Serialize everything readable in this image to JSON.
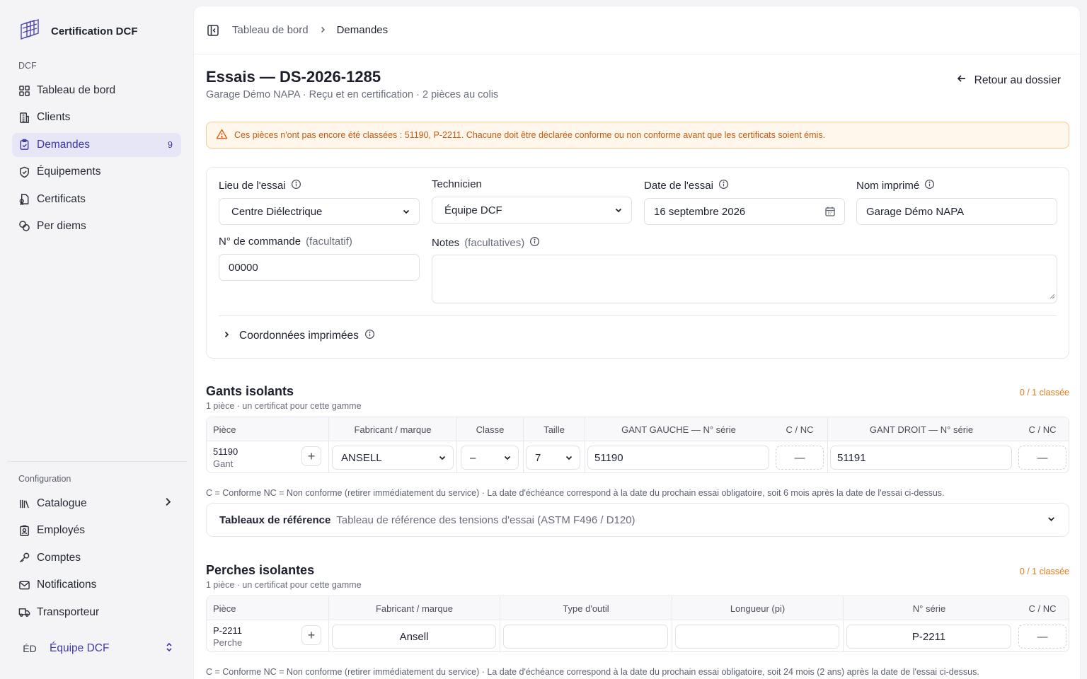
{
  "brand": {
    "name": "Certification DCF"
  },
  "sidebar": {
    "section_dcf": "DCF",
    "items": [
      {
        "label": "Tableau de bord",
        "icon": "dashboard-icon"
      },
      {
        "label": "Clients",
        "icon": "building-icon"
      },
      {
        "label": "Demandes",
        "icon": "clipboard-icon",
        "badge": "9",
        "active": true
      },
      {
        "label": "Équipements",
        "icon": "shield-icon"
      },
      {
        "label": "Certificats",
        "icon": "certificate-icon"
      },
      {
        "label": "Per diems",
        "icon": "coins-icon"
      }
    ],
    "section_config": "Configuration",
    "config_items": [
      {
        "label": "Catalogue",
        "icon": "library-icon"
      },
      {
        "label": "Employés",
        "icon": "badge-icon"
      },
      {
        "label": "Comptes",
        "icon": "key-icon"
      },
      {
        "label": "Notifications",
        "icon": "mail-icon"
      },
      {
        "label": "Transporteur",
        "icon": "truck-icon"
      }
    ],
    "team": {
      "initials": "ÉD",
      "name": "Équipe DCF"
    }
  },
  "breadcrumb": {
    "parent": "Tableau de bord",
    "current": "Demandes"
  },
  "header": {
    "title": "Essais — DS-2026-1285",
    "subtitle": "Garage Démo NAPA · Reçu et en certification · 2 pièces au colis",
    "back_label": "Retour au dossier"
  },
  "alert": "Ces pièces n'ont pas encore été classées : 51190, P-2211. Chacune doit être déclarée conforme ou non conforme avant que les certificats soient émis.",
  "form": {
    "location": {
      "label": "Lieu de l'essai",
      "value": "Centre Diélectrique"
    },
    "technician": {
      "label": "Technicien",
      "value": "Équipe DCF"
    },
    "date": {
      "label": "Date de l'essai",
      "value": "16 septembre 2026"
    },
    "printed_name": {
      "label": "Nom imprimé",
      "value": "Garage Démo NAPA"
    },
    "order": {
      "label": "N° de commande",
      "optional": "(facultatif)",
      "value": "00000"
    },
    "notes": {
      "label": "Notes",
      "optional": "(facultatives)",
      "value": ""
    },
    "coords_label": "Coordonnées imprimées"
  },
  "gloves": {
    "title": "Gants isolants",
    "subtitle": "1 pièce · un certificat pour cette gamme",
    "count": "0 / 1 classée",
    "headers": {
      "piece": "Pièce",
      "maker": "Fabricant / marque",
      "class": "Classe",
      "size": "Taille",
      "left": "GANT GAUCHE — N° série",
      "cnc1": "C / NC",
      "right": "GANT DROIT — N° série",
      "cnc2": "C / NC"
    },
    "row": {
      "id": "51190",
      "type": "Gant",
      "maker": "ANSELL",
      "class": "–",
      "size": "7",
      "left_serial": "51190",
      "cnc1": "—",
      "right_serial": "51191",
      "cnc2": "—"
    },
    "legend": "C = Conforme NC = Non conforme (retirer immédiatement du service) · La date d'échéance correspond à la date du prochain essai obligatoire, soit 6 mois après la date de l'essai ci-dessus."
  },
  "reference": {
    "title": "Tableaux de référence",
    "desc": "Tableau de référence des tensions d'essai (ASTM F496 / D120)"
  },
  "poles": {
    "title": "Perches isolantes",
    "subtitle": "1 pièce · un certificat pour cette gamme",
    "count": "0 / 1 classée",
    "headers": {
      "piece": "Pièce",
      "maker": "Fabricant / marque",
      "tool": "Type d'outil",
      "length": "Longueur (pi)",
      "serial": "N° série",
      "cnc": "C / NC"
    },
    "row": {
      "id": "P-2211",
      "type": "Perche",
      "maker": "Ansell",
      "tool": "",
      "length": "",
      "serial": "P-2211",
      "cnc": "—"
    },
    "legend": "C = Conforme NC = Non conforme (retirer immédiatement du service) · La date d'échéance correspond à la date du prochain essai obligatoire, soit 24 mois (2 ans) après la date de l'essai ci-dessus."
  }
}
